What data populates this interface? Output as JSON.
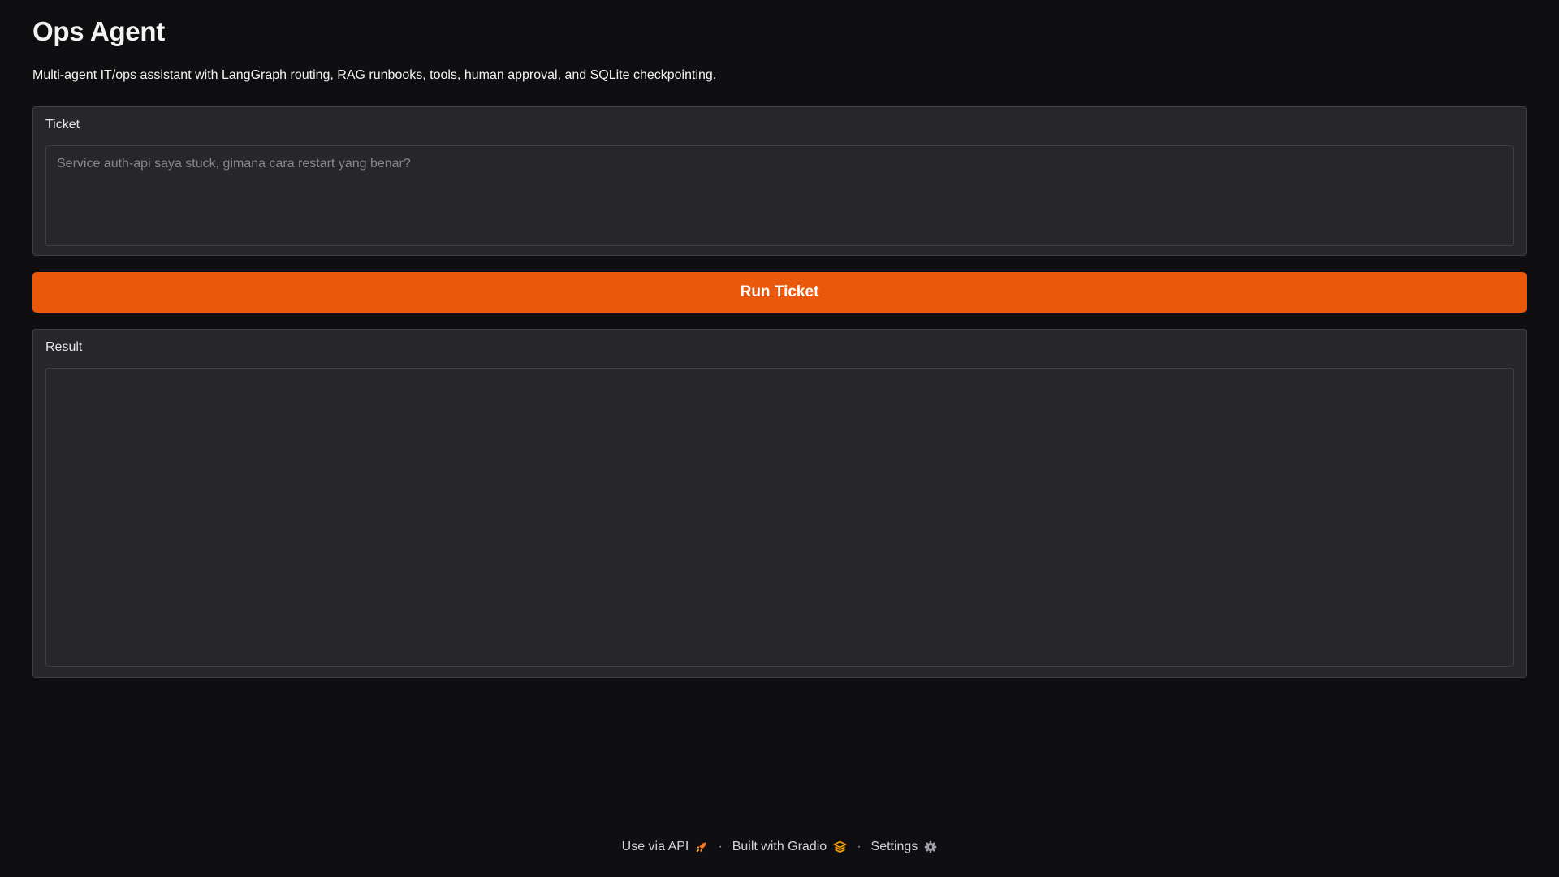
{
  "app": {
    "title": "Ops Agent",
    "description": "Multi-agent IT/ops assistant with LangGraph routing, RAG runbooks, tools, human approval, and SQLite checkpointing."
  },
  "ticket": {
    "label": "Ticket",
    "value": "",
    "placeholder": "Service auth-api saya stuck, gimana cara restart yang benar?"
  },
  "run_button": {
    "label": "Run Ticket"
  },
  "result": {
    "label": "Result",
    "value": ""
  },
  "footer": {
    "api_label": "Use via API",
    "api_icon": "rocket-icon",
    "built_label": "Built with Gradio",
    "built_icon": "gradio-logo-icon",
    "settings_label": "Settings",
    "settings_icon": "gear-icon",
    "separator": "·"
  },
  "colors": {
    "background": "#0f0f11",
    "panel": "#27272a",
    "accent": "#ea580c"
  }
}
